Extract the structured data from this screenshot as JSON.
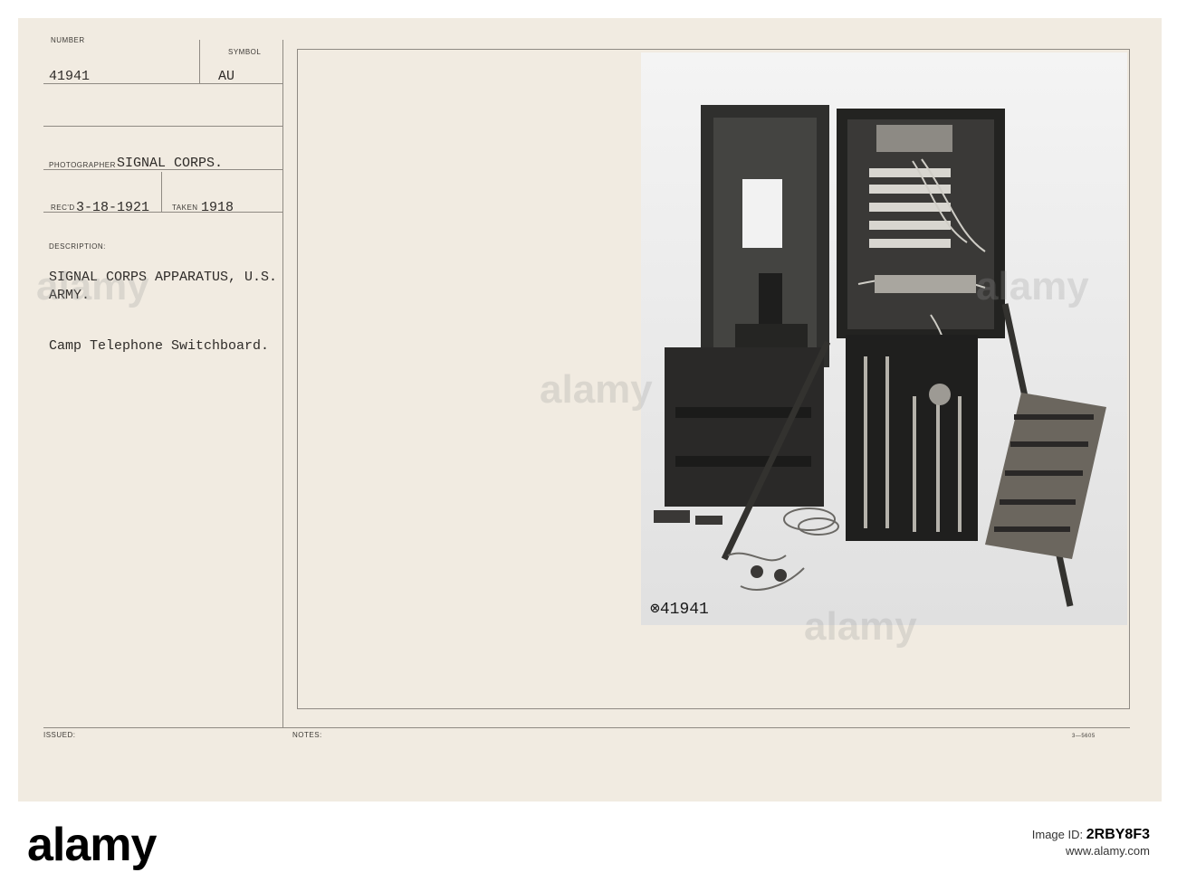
{
  "card": {
    "number_label": "NUMBER",
    "number_value": "41941",
    "symbol_label": "SYMBOL",
    "symbol_value": "AU",
    "photographer_label": "PHOTOGRAPHER",
    "photographer_value": "SIGNAL CORPS.",
    "recd_label": "REC'D",
    "recd_value": "3-18-1921",
    "taken_label": "TAKEN",
    "taken_value": "1918",
    "description_label": "DESCRIPTION:",
    "description_line1": "SIGNAL CORPS APPARATUS, U.S.",
    "description_line2": "ARMY.",
    "caption": "Camp Telephone Switchboard.",
    "issued_label": "ISSUED:",
    "notes_label": "NOTES:",
    "form_number": "3—5605"
  },
  "photo": {
    "handwritten_number": "⊗41941"
  },
  "watermark": {
    "text": "alamy"
  },
  "footer": {
    "brand": "alamy",
    "image_id_label": "Image ID:",
    "image_id": "2RBY8F3",
    "site": "www.alamy.com"
  }
}
